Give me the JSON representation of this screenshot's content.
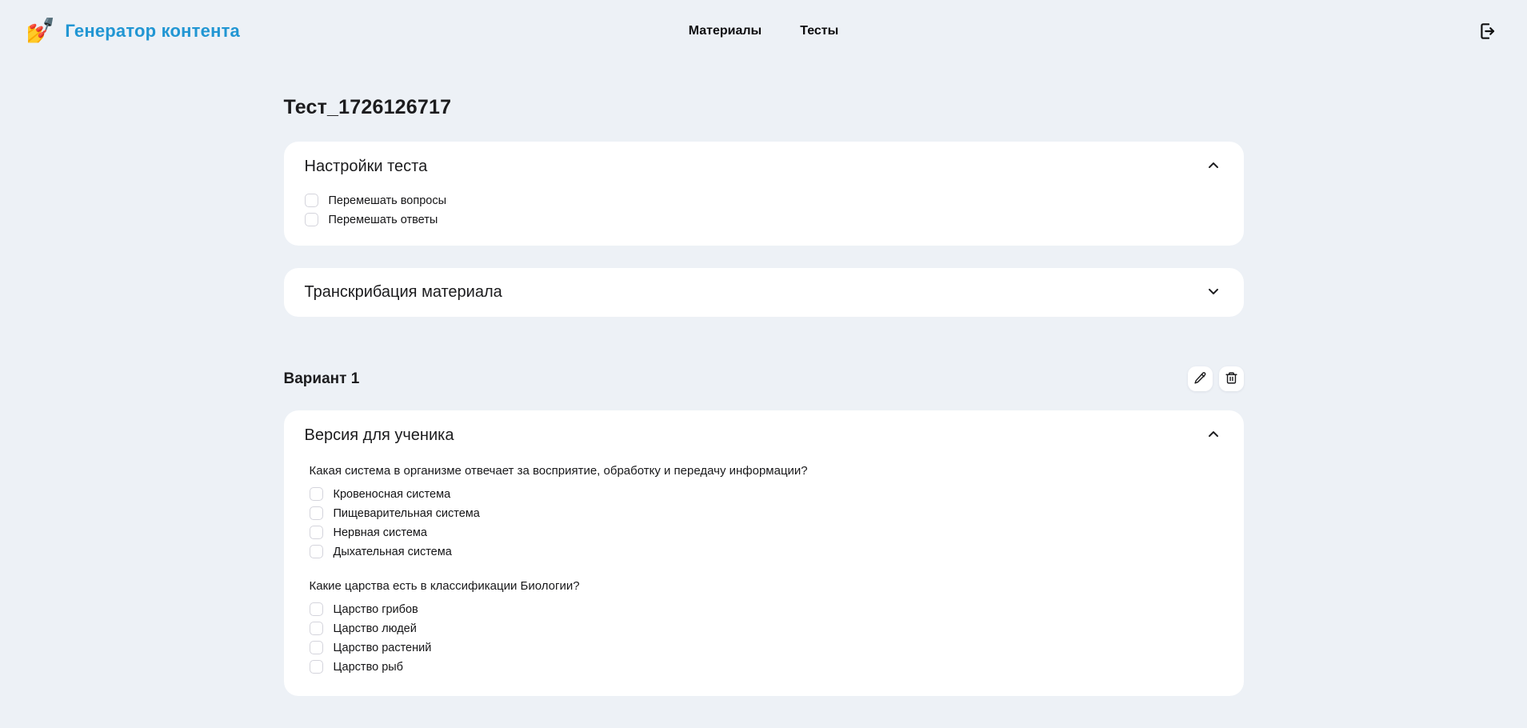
{
  "colors": {
    "page_bg": "#edf1f6",
    "card_bg": "#ffffff",
    "brand_blue": "#2196d3",
    "text": "#1c1c1e",
    "checkbox_border": "#d4d4dc"
  },
  "icons": {
    "logo": "nail-polish emoji",
    "logout": "door-with-right-arrow",
    "collapse": "chevron-up",
    "expand": "chevron-down",
    "edit": "pencil-outline",
    "delete": "trash-can-outline"
  },
  "header": {
    "logo_emoji": "💅",
    "brand_title": "Генератор контента",
    "nav": [
      {
        "label": "Материалы"
      },
      {
        "label": "Тесты"
      }
    ]
  },
  "page": {
    "title": "Тест_1726126717"
  },
  "settings_card": {
    "title": "Настройки теста",
    "collapsed": false,
    "checkboxes": [
      {
        "label": "Перемешать вопросы",
        "checked": false
      },
      {
        "label": "Перемешать ответы",
        "checked": false
      }
    ]
  },
  "transcription_card": {
    "title": "Транскрибация материала",
    "collapsed": true
  },
  "variant": {
    "title": "Вариант 1"
  },
  "student_version_card": {
    "title": "Версия для ученика",
    "collapsed": false,
    "questions": [
      {
        "text": "Какая система в организме отвечает за восприятие, обработку и передачу информации?",
        "options": [
          {
            "label": "Кровеносная система",
            "checked": false
          },
          {
            "label": "Пищеварительная система",
            "checked": false
          },
          {
            "label": "Нервная система",
            "checked": false
          },
          {
            "label": "Дыхательная система",
            "checked": false
          }
        ]
      },
      {
        "text": "Какие царства есть в классификации Биологии?",
        "options": [
          {
            "label": "Царство грибов",
            "checked": false
          },
          {
            "label": "Царство людей",
            "checked": false
          },
          {
            "label": "Царство растений",
            "checked": false
          },
          {
            "label": "Царство рыб",
            "checked": false
          }
        ]
      }
    ]
  }
}
